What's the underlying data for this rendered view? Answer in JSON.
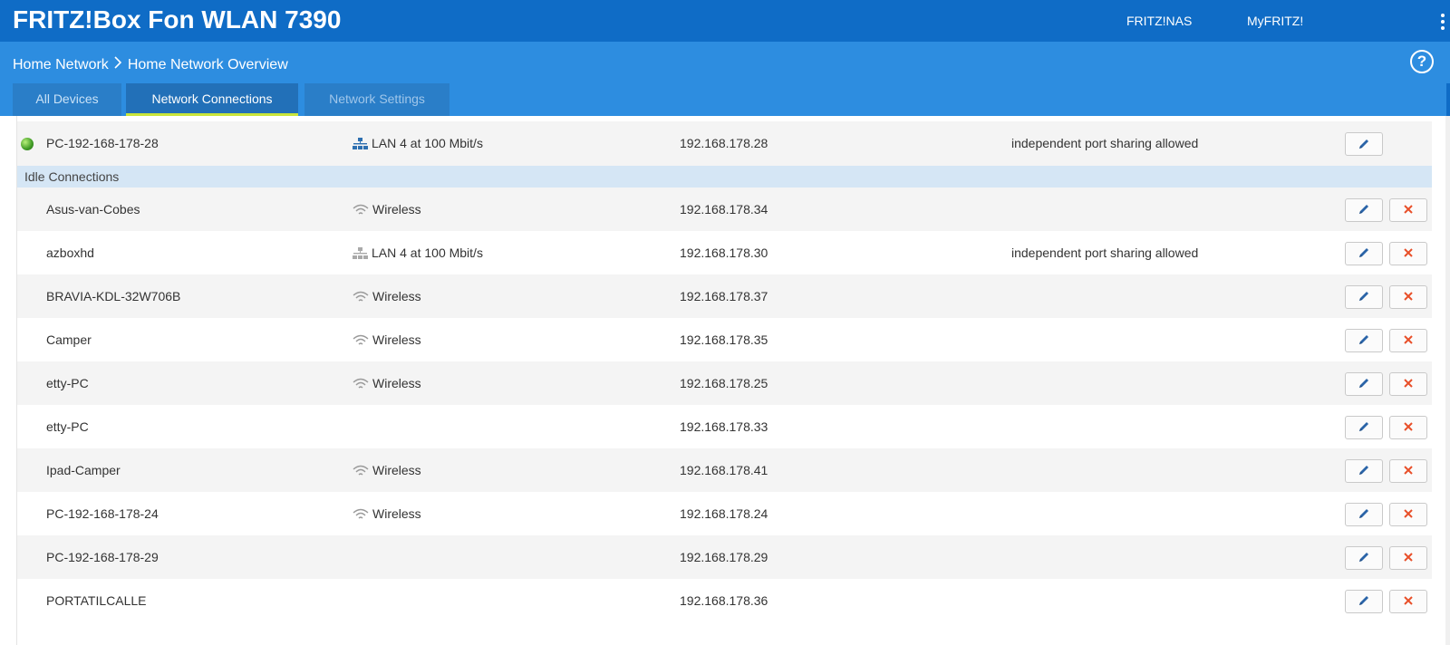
{
  "header": {
    "title": "FRITZ!Box Fon WLAN 7390",
    "links": [
      "FRITZ!NAS",
      "MyFRITZ!"
    ]
  },
  "breadcrumb": {
    "parent": "Home Network",
    "separator": ">",
    "current": "Home Network Overview"
  },
  "tabs": [
    {
      "label": "All Devices",
      "active": false
    },
    {
      "label": "Network Connections",
      "active": true
    },
    {
      "label": "Network Settings",
      "active": false
    }
  ],
  "active_connections": [
    {
      "name": "PC-192-168-178-28",
      "connection": "LAN 4 at 100 Mbit/s",
      "connection_type": "lan",
      "ip": "192.168.178.28",
      "ports": "independent port sharing allowed",
      "status_icon": "globe-icon"
    }
  ],
  "idle_section_title": "Idle Connections",
  "idle_connections": [
    {
      "name": "Asus-van-Cobes",
      "connection": "Wireless",
      "connection_type": "wireless",
      "ip": "192.168.178.34",
      "ports": ""
    },
    {
      "name": "azboxhd",
      "connection": "LAN 4 at 100 Mbit/s",
      "connection_type": "lan",
      "ip": "192.168.178.30",
      "ports": "independent port sharing allowed"
    },
    {
      "name": "BRAVIA-KDL-32W706B",
      "connection": "Wireless",
      "connection_type": "wireless",
      "ip": "192.168.178.37",
      "ports": ""
    },
    {
      "name": "Camper",
      "connection": "Wireless",
      "connection_type": "wireless",
      "ip": "192.168.178.35",
      "ports": ""
    },
    {
      "name": "etty-PC",
      "connection": "Wireless",
      "connection_type": "wireless",
      "ip": "192.168.178.25",
      "ports": ""
    },
    {
      "name": "etty-PC",
      "connection": "",
      "connection_type": "none",
      "ip": "192.168.178.33",
      "ports": ""
    },
    {
      "name": "Ipad-Camper",
      "connection": "Wireless",
      "connection_type": "wireless",
      "ip": "192.168.178.41",
      "ports": ""
    },
    {
      "name": "PC-192-168-178-24",
      "connection": "Wireless",
      "connection_type": "wireless",
      "ip": "192.168.178.24",
      "ports": ""
    },
    {
      "name": "PC-192-168-178-29",
      "connection": "",
      "connection_type": "none",
      "ip": "192.168.178.29",
      "ports": ""
    },
    {
      "name": "PORTATILCALLE",
      "connection": "",
      "connection_type": "none",
      "ip": "192.168.178.36",
      "ports": ""
    }
  ],
  "colors": {
    "topbar": "#0f6cc6",
    "subbar": "#2d8de0",
    "active_tab_underline": "#c9e53b",
    "section_header": "#d5e6f5",
    "edit_icon": "#2a64a8",
    "delete_icon": "#e8502a"
  }
}
